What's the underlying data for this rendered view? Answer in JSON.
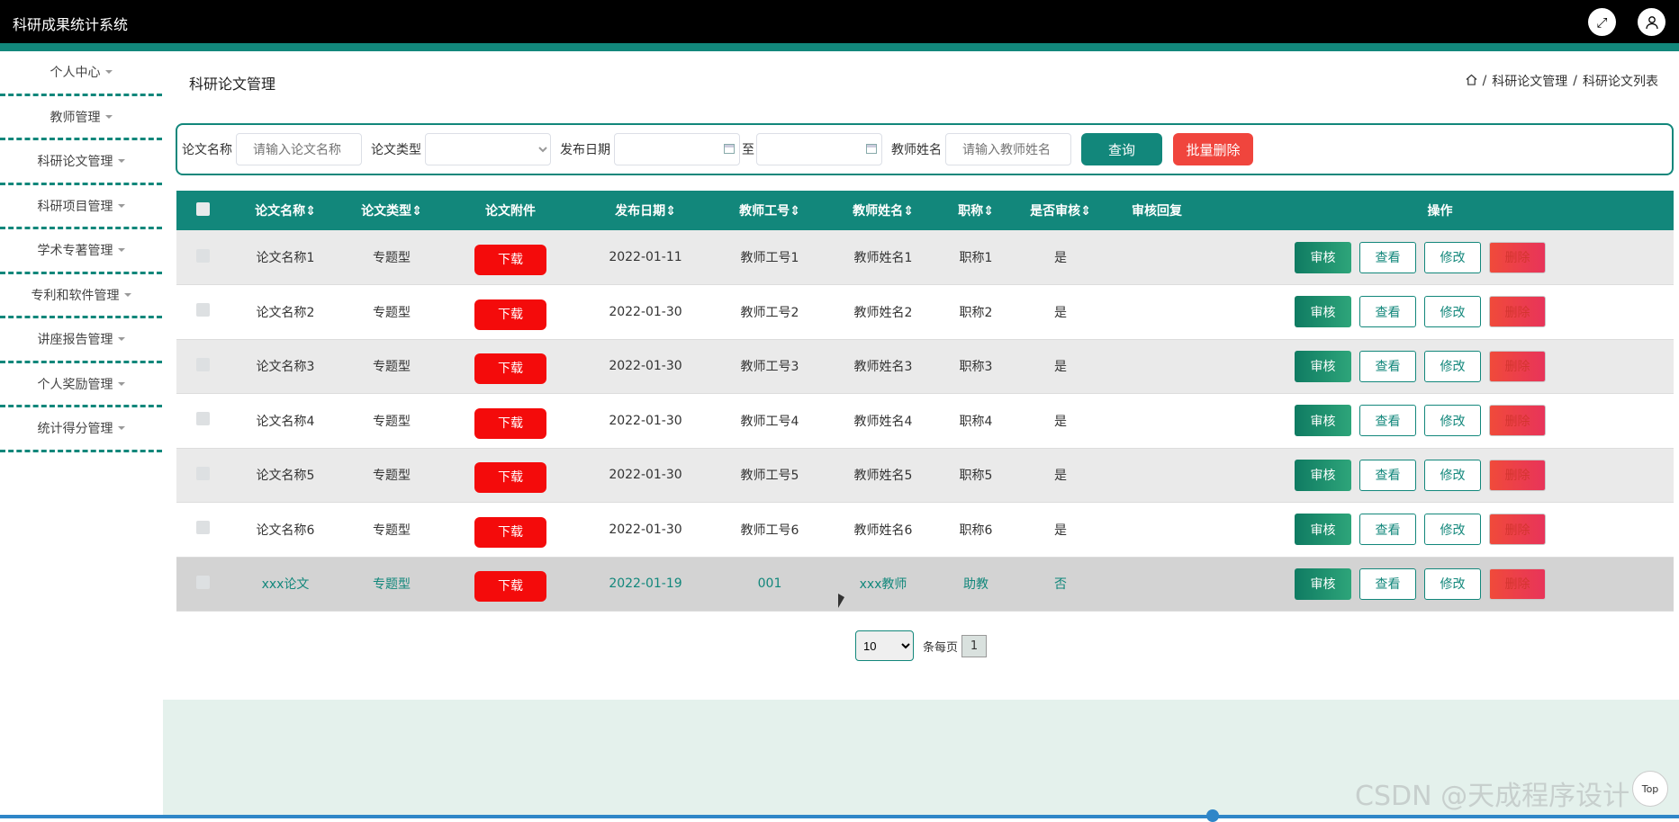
{
  "app": {
    "title": "科研成果统计系统"
  },
  "icons": {
    "expand": "expand-icon",
    "user": "user-icon",
    "home": "home-icon"
  },
  "sidebar": {
    "items": [
      {
        "label": "个人中心"
      },
      {
        "label": "教师管理"
      },
      {
        "label": "科研论文管理"
      },
      {
        "label": "科研项目管理"
      },
      {
        "label": "学术专著管理"
      },
      {
        "label": "专利和软件管理"
      },
      {
        "label": "讲座报告管理"
      },
      {
        "label": "个人奖励管理"
      },
      {
        "label": "统计得分管理"
      }
    ]
  },
  "page": {
    "title": "科研论文管理"
  },
  "breadcrumb": {
    "sep1": "/",
    "item1": "科研论文管理",
    "sep2": "/",
    "item2": "科研论文列表"
  },
  "search": {
    "name_label": "论文名称",
    "name_placeholder": "请输入论文名称",
    "type_label": "论文类型",
    "type_value": "",
    "date_label": "发布日期",
    "date_to": "至",
    "teacher_label": "教师姓名",
    "teacher_placeholder": "请输入教师姓名",
    "query_label": "查询",
    "batch_delete_label": "批量删除"
  },
  "table": {
    "headers": {
      "name": "论文名称",
      "type": "论文类型",
      "attach": "论文附件",
      "date": "发布日期",
      "tno": "教师工号",
      "tname": "教师姓名",
      "title": "职称",
      "audit": "是否审核",
      "reply": "审核回复",
      "ops": "操作"
    },
    "sort_glyph": "⇕",
    "download_label": "下载",
    "op_labels": {
      "audit": "审核",
      "view": "查看",
      "edit": "修改",
      "delete": "删除"
    },
    "rows": [
      {
        "name": "论文名称1",
        "type": "专题型",
        "date": "2022-01-11",
        "tno": "教师工号1",
        "tname": "教师姓名1",
        "title": "职称1",
        "audit": "是",
        "reply": ""
      },
      {
        "name": "论文名称2",
        "type": "专题型",
        "date": "2022-01-30",
        "tno": "教师工号2",
        "tname": "教师姓名2",
        "title": "职称2",
        "audit": "是",
        "reply": ""
      },
      {
        "name": "论文名称3",
        "type": "专题型",
        "date": "2022-01-30",
        "tno": "教师工号3",
        "tname": "教师姓名3",
        "title": "职称3",
        "audit": "是",
        "reply": ""
      },
      {
        "name": "论文名称4",
        "type": "专题型",
        "date": "2022-01-30",
        "tno": "教师工号4",
        "tname": "教师姓名4",
        "title": "职称4",
        "audit": "是",
        "reply": ""
      },
      {
        "name": "论文名称5",
        "type": "专题型",
        "date": "2022-01-30",
        "tno": "教师工号5",
        "tname": "教师姓名5",
        "title": "职称5",
        "audit": "是",
        "reply": ""
      },
      {
        "name": "论文名称6",
        "type": "专题型",
        "date": "2022-01-30",
        "tno": "教师工号6",
        "tname": "教师姓名6",
        "title": "职称6",
        "audit": "是",
        "reply": ""
      },
      {
        "name": "xxx论文",
        "type": "专题型",
        "date": "2022-01-19",
        "tno": "001",
        "tname": "xxx教师",
        "title": "助教",
        "audit": "否",
        "reply": ""
      }
    ]
  },
  "pager": {
    "page_size": "10",
    "per_page_label": "条每页",
    "current_page": "1"
  },
  "footer": {
    "top_label": "Top",
    "watermark": "CSDN @天成程序设计"
  },
  "colors": {
    "brand": "#12877b",
    "danger": "#f40b0b",
    "topbar": "#000000"
  }
}
